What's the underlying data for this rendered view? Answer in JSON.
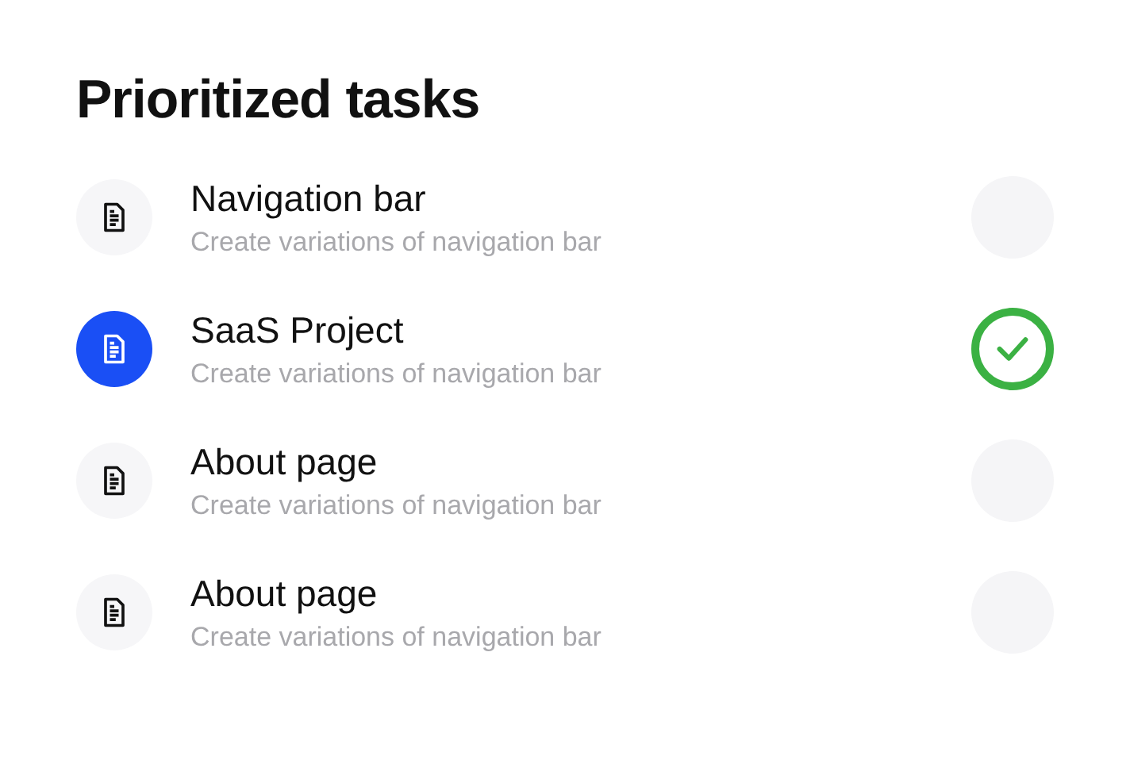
{
  "title": "Prioritized tasks",
  "tasks": [
    {
      "name": "Navigation bar",
      "description": "Create variations of navigation bar",
      "selected": false,
      "done": false
    },
    {
      "name": "SaaS Project",
      "description": "Create variations of navigation bar",
      "selected": true,
      "done": true
    },
    {
      "name": "About page",
      "description": "Create variations of navigation bar",
      "selected": false,
      "done": false
    },
    {
      "name": "About page",
      "description": "Create variations of navigation bar",
      "selected": false,
      "done": false
    }
  ]
}
